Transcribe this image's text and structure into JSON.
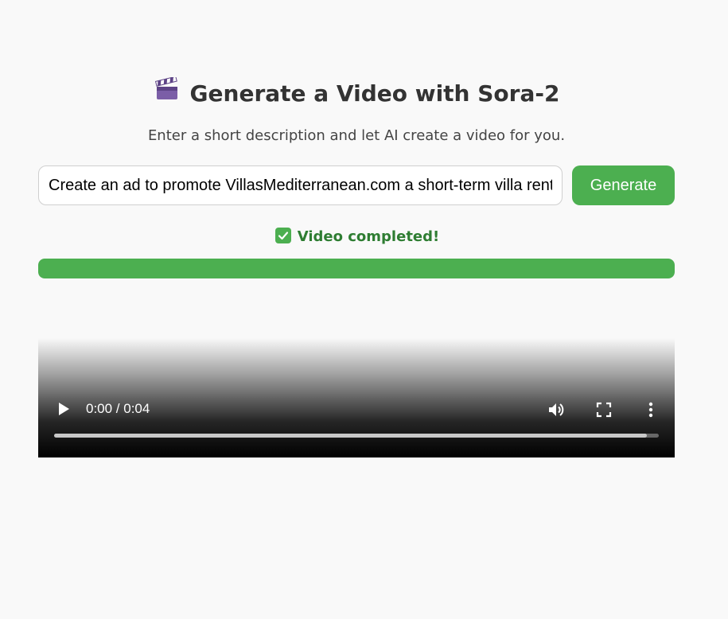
{
  "header": {
    "icon": "clapper-board-icon",
    "title": "Generate a Video with Sora-2",
    "subtitle": "Enter a short description and let AI create a video for you."
  },
  "form": {
    "prompt_value": "Create an ad to promote VillasMediterranean.com a short-term villa rental website",
    "generate_label": "Generate"
  },
  "status": {
    "icon": "check-box-icon",
    "text": "Video completed!",
    "progress": 1.0
  },
  "video": {
    "time_label": "0:00 / 0:04",
    "buffered": 0.98,
    "controls": [
      "play-icon",
      "volume-icon",
      "fullscreen-icon",
      "more-vertical-icon"
    ]
  },
  "colors": {
    "accent": "#4caf50",
    "status_text": "#2e7d32",
    "background": "#f9f9f9"
  }
}
